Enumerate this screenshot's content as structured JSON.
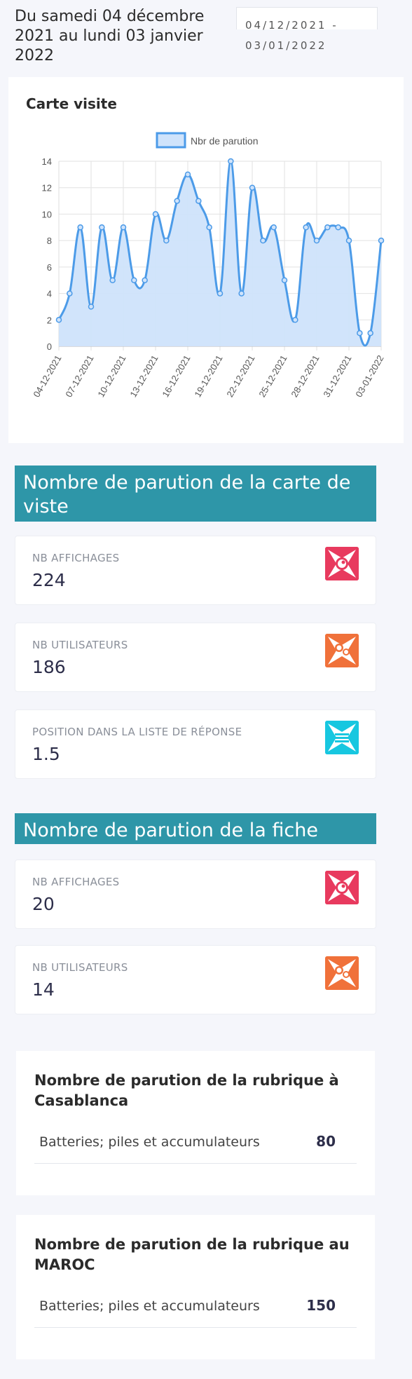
{
  "header": {
    "period_text": "Du samedi 04 décembre 2021 au lundi 03 janvier 2022",
    "date_range": "04/12/2021 - 03/01/2022"
  },
  "chart_card": {
    "title": "Carte visite"
  },
  "chart_data": {
    "type": "area",
    "title": "",
    "legend": [
      "Nbr de parution"
    ],
    "legend_position": "top",
    "x": [
      "04-12-2021",
      "05-12-2021",
      "06-12-2021",
      "07-12-2021",
      "08-12-2021",
      "09-12-2021",
      "10-12-2021",
      "11-12-2021",
      "12-12-2021",
      "13-12-2021",
      "14-12-2021",
      "15-12-2021",
      "16-12-2021",
      "17-12-2021",
      "18-12-2021",
      "19-12-2021",
      "20-12-2021",
      "21-12-2021",
      "22-12-2021",
      "23-12-2021",
      "24-12-2021",
      "25-12-2021",
      "26-12-2021",
      "27-12-2021",
      "28-12-2021",
      "29-12-2021",
      "30-12-2021",
      "31-12-2021",
      "01-01-2022",
      "02-01-2022",
      "03-01-2022"
    ],
    "tick_labels": [
      "04-12-2021",
      "07-12-2021",
      "10-12-2021",
      "13-12-2021",
      "16-12-2021",
      "19-12-2021",
      "22-12-2021",
      "25-12-2021",
      "28-12-2021",
      "31-12-2021",
      "03-01-2022"
    ],
    "series": [
      {
        "name": "Nbr de parution",
        "values": [
          2,
          4,
          9,
          3,
          9,
          5,
          9,
          5,
          5,
          10,
          8,
          11,
          13,
          11,
          9,
          4,
          14,
          4,
          12,
          8,
          9,
          5,
          2,
          9,
          8,
          9,
          9,
          8,
          1,
          1,
          8
        ]
      }
    ],
    "ylim": [
      0,
      14
    ],
    "yticks": [
      0,
      2,
      4,
      6,
      8,
      10,
      12,
      14
    ],
    "grid": true,
    "colors": {
      "line": "#4c9be8",
      "fill": "#cfe3fb"
    }
  },
  "section_carte": {
    "title": "Nombre de parution de la carte de viste",
    "stats": [
      {
        "label": "NB AFFICHAGES",
        "value": "224",
        "icon": "eye-icon",
        "color": "#e83a5e"
      },
      {
        "label": "NB UTILISATEURS",
        "value": "186",
        "icon": "users-icon",
        "color": "#f0713a"
      },
      {
        "label": "POSITION DANS LA LISTE DE RÉPONSE",
        "value": "1.5",
        "icon": "list-icon",
        "color": "#17c7e0"
      }
    ]
  },
  "section_fiche": {
    "title": "Nombre de parution de la fiche",
    "stats": [
      {
        "label": "NB AFFICHAGES",
        "value": "20",
        "icon": "eye-icon",
        "color": "#e83a5e"
      },
      {
        "label": "NB UTILISATEURS",
        "value": "14",
        "icon": "users-icon",
        "color": "#f0713a"
      }
    ]
  },
  "rubrique_casablanca": {
    "title": "Nombre de parution de la rubrique à Casablanca",
    "rows": [
      {
        "name": "Batteries; piles et accumulateurs",
        "count": "80"
      }
    ]
  },
  "rubrique_maroc": {
    "title": "Nombre de parution de la rubrique au MAROC",
    "rows": [
      {
        "name": "Batteries; piles et accumulateurs",
        "count": "150"
      }
    ]
  }
}
